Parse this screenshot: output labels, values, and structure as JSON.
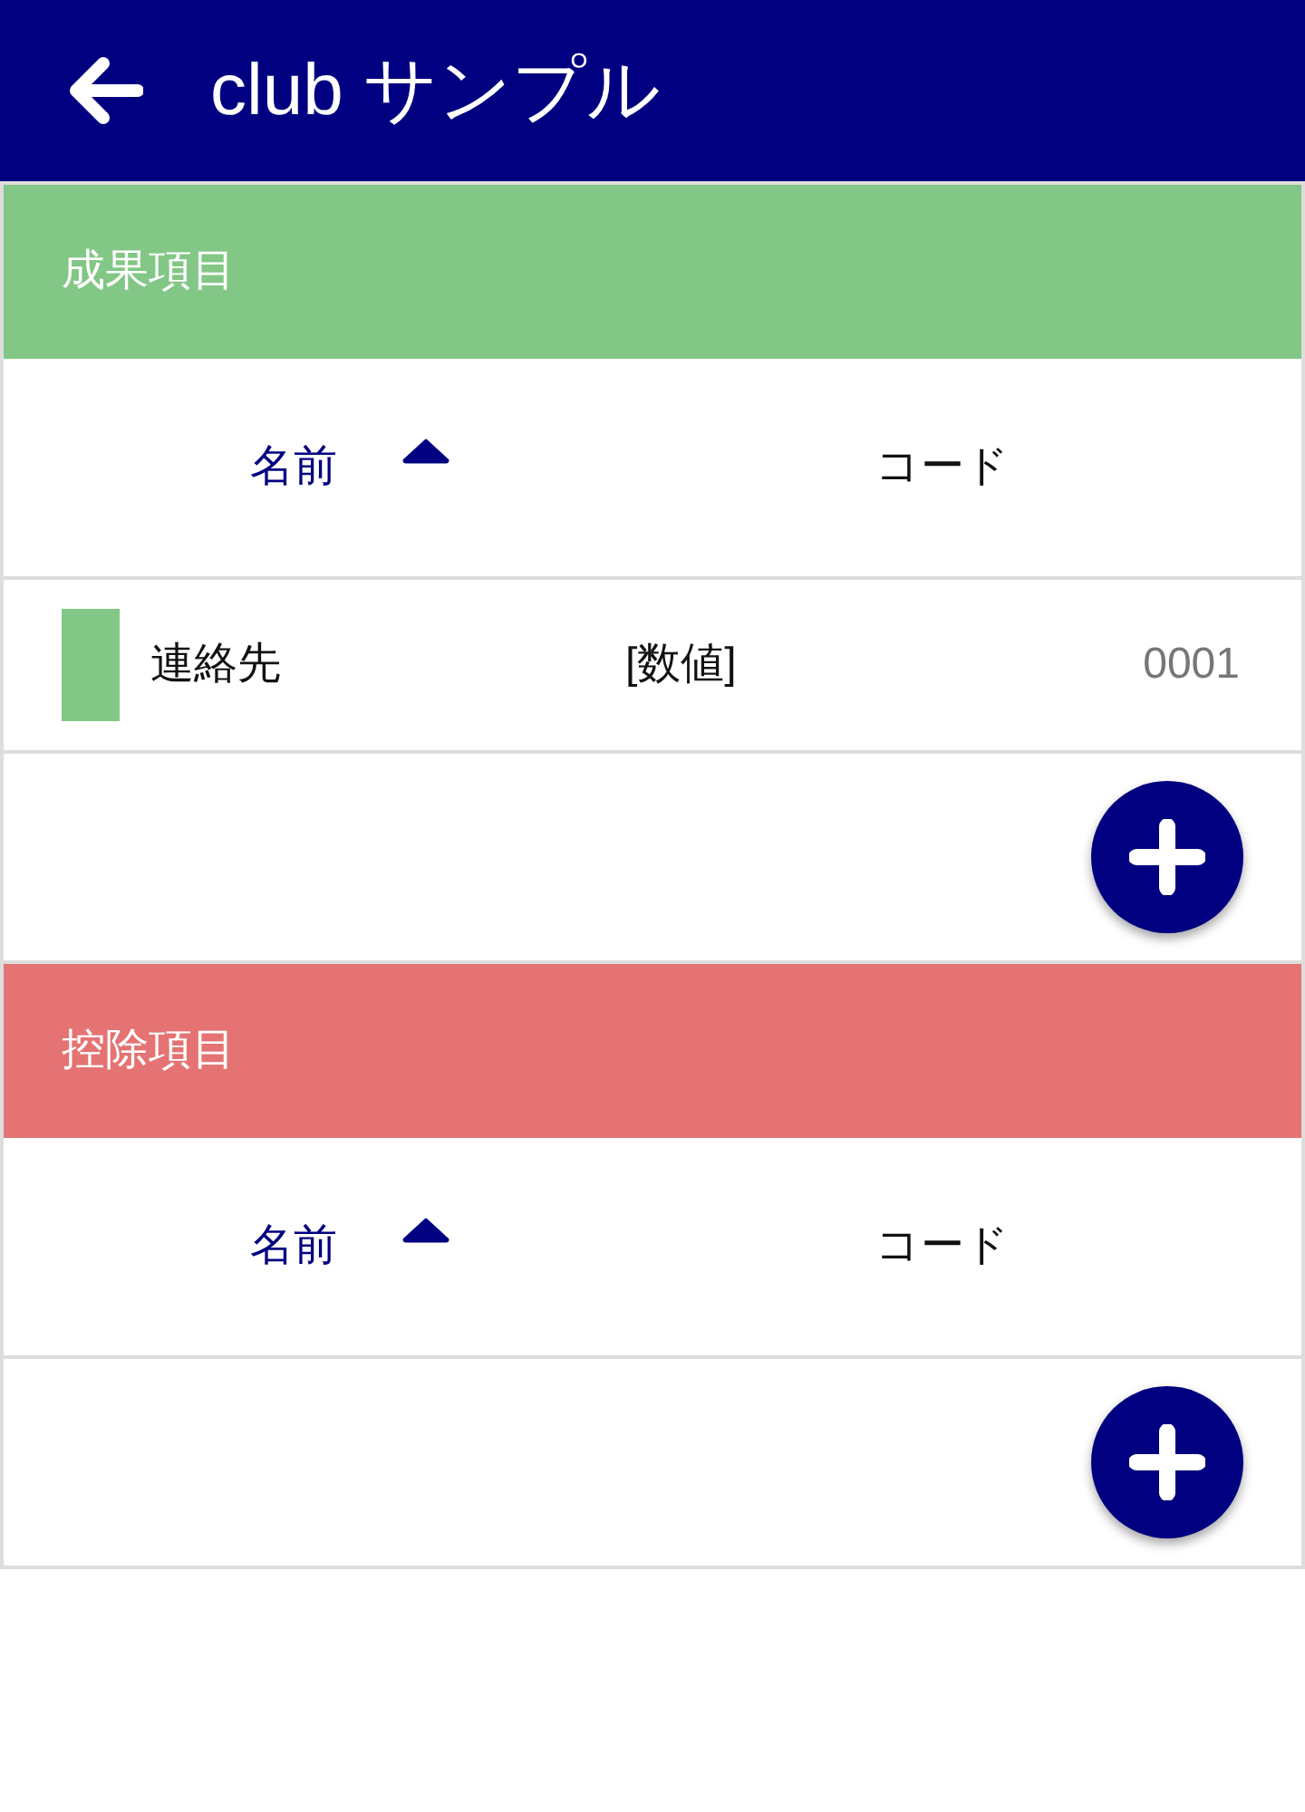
{
  "app_bar": {
    "title": "club サンプル"
  },
  "sections": [
    {
      "title": "成果項目",
      "color": "#82c785",
      "columns": [
        {
          "label": "名前",
          "sorted": true,
          "ascending": true
        },
        {
          "label": "コード",
          "sorted": false
        }
      ],
      "rows": [
        {
          "name": "連絡先",
          "value_type": "[数値]",
          "code": "0001",
          "color": "#82c785"
        }
      ]
    },
    {
      "title": "控除項目",
      "color": "#e57373",
      "columns": [
        {
          "label": "名前",
          "sorted": true,
          "ascending": true
        },
        {
          "label": "コード",
          "sorted": false
        }
      ]
    }
  ]
}
